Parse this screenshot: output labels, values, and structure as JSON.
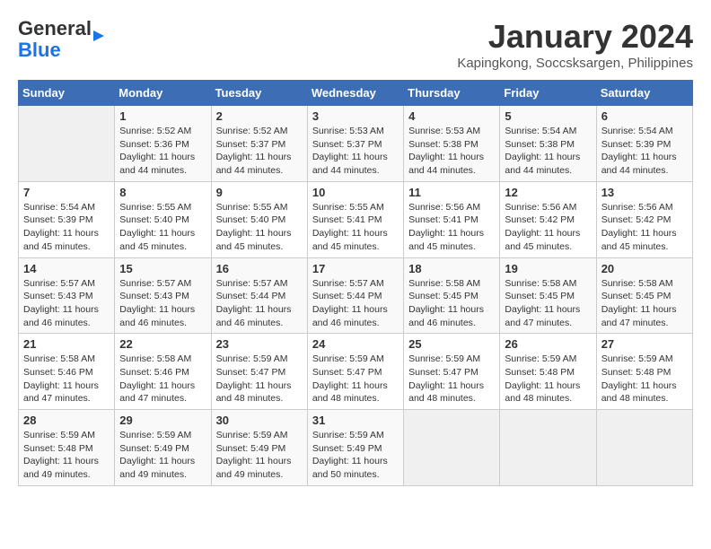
{
  "header": {
    "logo_general": "General",
    "logo_blue": "Blue",
    "title": "January 2024",
    "subtitle": "Kapingkong, Soccsksargen, Philippines"
  },
  "days_of_week": [
    "Sunday",
    "Monday",
    "Tuesday",
    "Wednesday",
    "Thursday",
    "Friday",
    "Saturday"
  ],
  "weeks": [
    [
      {
        "day": "",
        "sunrise": "",
        "sunset": "",
        "daylight": ""
      },
      {
        "day": "1",
        "sunrise": "5:52 AM",
        "sunset": "5:36 PM",
        "daylight": "11 hours and 44 minutes."
      },
      {
        "day": "2",
        "sunrise": "5:52 AM",
        "sunset": "5:37 PM",
        "daylight": "11 hours and 44 minutes."
      },
      {
        "day": "3",
        "sunrise": "5:53 AM",
        "sunset": "5:37 PM",
        "daylight": "11 hours and 44 minutes."
      },
      {
        "day": "4",
        "sunrise": "5:53 AM",
        "sunset": "5:38 PM",
        "daylight": "11 hours and 44 minutes."
      },
      {
        "day": "5",
        "sunrise": "5:54 AM",
        "sunset": "5:38 PM",
        "daylight": "11 hours and 44 minutes."
      },
      {
        "day": "6",
        "sunrise": "5:54 AM",
        "sunset": "5:39 PM",
        "daylight": "11 hours and 44 minutes."
      }
    ],
    [
      {
        "day": "7",
        "sunrise": "5:54 AM",
        "sunset": "5:39 PM",
        "daylight": "11 hours and 45 minutes."
      },
      {
        "day": "8",
        "sunrise": "5:55 AM",
        "sunset": "5:40 PM",
        "daylight": "11 hours and 45 minutes."
      },
      {
        "day": "9",
        "sunrise": "5:55 AM",
        "sunset": "5:40 PM",
        "daylight": "11 hours and 45 minutes."
      },
      {
        "day": "10",
        "sunrise": "5:55 AM",
        "sunset": "5:41 PM",
        "daylight": "11 hours and 45 minutes."
      },
      {
        "day": "11",
        "sunrise": "5:56 AM",
        "sunset": "5:41 PM",
        "daylight": "11 hours and 45 minutes."
      },
      {
        "day": "12",
        "sunrise": "5:56 AM",
        "sunset": "5:42 PM",
        "daylight": "11 hours and 45 minutes."
      },
      {
        "day": "13",
        "sunrise": "5:56 AM",
        "sunset": "5:42 PM",
        "daylight": "11 hours and 45 minutes."
      }
    ],
    [
      {
        "day": "14",
        "sunrise": "5:57 AM",
        "sunset": "5:43 PM",
        "daylight": "11 hours and 46 minutes."
      },
      {
        "day": "15",
        "sunrise": "5:57 AM",
        "sunset": "5:43 PM",
        "daylight": "11 hours and 46 minutes."
      },
      {
        "day": "16",
        "sunrise": "5:57 AM",
        "sunset": "5:44 PM",
        "daylight": "11 hours and 46 minutes."
      },
      {
        "day": "17",
        "sunrise": "5:57 AM",
        "sunset": "5:44 PM",
        "daylight": "11 hours and 46 minutes."
      },
      {
        "day": "18",
        "sunrise": "5:58 AM",
        "sunset": "5:45 PM",
        "daylight": "11 hours and 46 minutes."
      },
      {
        "day": "19",
        "sunrise": "5:58 AM",
        "sunset": "5:45 PM",
        "daylight": "11 hours and 47 minutes."
      },
      {
        "day": "20",
        "sunrise": "5:58 AM",
        "sunset": "5:45 PM",
        "daylight": "11 hours and 47 minutes."
      }
    ],
    [
      {
        "day": "21",
        "sunrise": "5:58 AM",
        "sunset": "5:46 PM",
        "daylight": "11 hours and 47 minutes."
      },
      {
        "day": "22",
        "sunrise": "5:58 AM",
        "sunset": "5:46 PM",
        "daylight": "11 hours and 47 minutes."
      },
      {
        "day": "23",
        "sunrise": "5:59 AM",
        "sunset": "5:47 PM",
        "daylight": "11 hours and 48 minutes."
      },
      {
        "day": "24",
        "sunrise": "5:59 AM",
        "sunset": "5:47 PM",
        "daylight": "11 hours and 48 minutes."
      },
      {
        "day": "25",
        "sunrise": "5:59 AM",
        "sunset": "5:47 PM",
        "daylight": "11 hours and 48 minutes."
      },
      {
        "day": "26",
        "sunrise": "5:59 AM",
        "sunset": "5:48 PM",
        "daylight": "11 hours and 48 minutes."
      },
      {
        "day": "27",
        "sunrise": "5:59 AM",
        "sunset": "5:48 PM",
        "daylight": "11 hours and 48 minutes."
      }
    ],
    [
      {
        "day": "28",
        "sunrise": "5:59 AM",
        "sunset": "5:48 PM",
        "daylight": "11 hours and 49 minutes."
      },
      {
        "day": "29",
        "sunrise": "5:59 AM",
        "sunset": "5:49 PM",
        "daylight": "11 hours and 49 minutes."
      },
      {
        "day": "30",
        "sunrise": "5:59 AM",
        "sunset": "5:49 PM",
        "daylight": "11 hours and 49 minutes."
      },
      {
        "day": "31",
        "sunrise": "5:59 AM",
        "sunset": "5:49 PM",
        "daylight": "11 hours and 50 minutes."
      },
      {
        "day": "",
        "sunrise": "",
        "sunset": "",
        "daylight": ""
      },
      {
        "day": "",
        "sunrise": "",
        "sunset": "",
        "daylight": ""
      },
      {
        "day": "",
        "sunrise": "",
        "sunset": "",
        "daylight": ""
      }
    ]
  ]
}
